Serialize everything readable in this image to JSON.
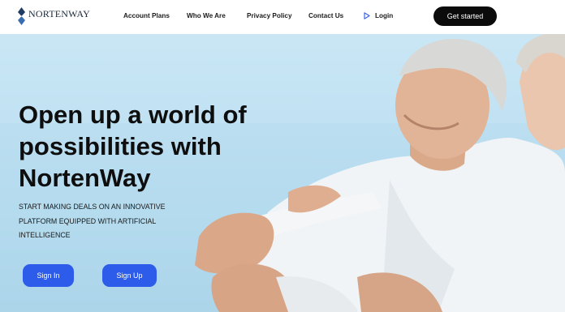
{
  "brand": {
    "name": "NORTENWAY",
    "logo_icon": "diamond-logo-icon"
  },
  "nav": {
    "items": [
      {
        "label": "Account Plans"
      },
      {
        "label": "Who We Are"
      },
      {
        "label": "Privacy Policy"
      },
      {
        "label": "Contact Us"
      }
    ],
    "login_label": "Login",
    "login_icon": "play-triangle-icon",
    "cta_label": "Get started"
  },
  "hero": {
    "headline": "Open up a world of possibilities with NortenWay",
    "subtext": "START MAKING DEALS ON AN INNOVATIVE PLATFORM EQUIPPED WITH ARTIFICIAL INTELLIGENCE",
    "sign_in_label": "Sign In",
    "sign_up_label": "Sign Up"
  },
  "colors": {
    "accent": "#2d5bea",
    "cta_bg": "#0b0b0b",
    "sky": "#bfe1f3"
  }
}
